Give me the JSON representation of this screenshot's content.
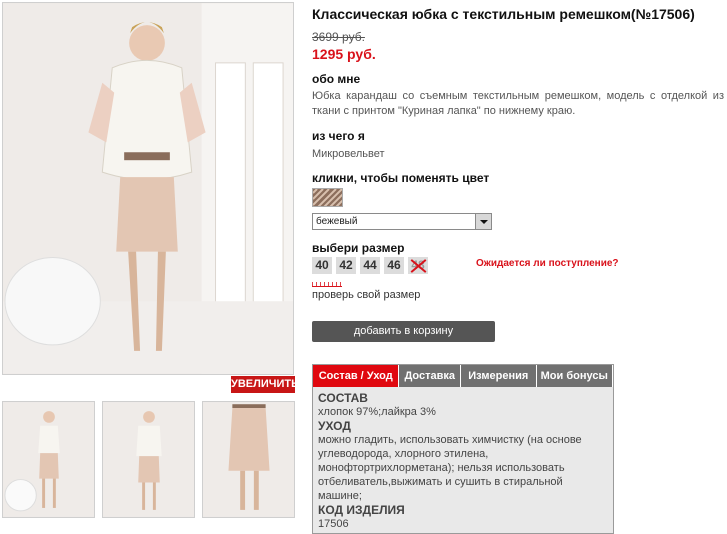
{
  "product": {
    "title": "Классическая юбка с текстильным ремешком(№17506)",
    "old_price": "3699 руб.",
    "new_price": "1295 руб."
  },
  "gallery": {
    "zoom_label": "УВЕЛИЧИТЬ"
  },
  "about": {
    "heading": "обо мне",
    "text": "Юбка карандаш со съемным текстильным ремешком, модель с отделкой из ткани с принтом \"Куриная лапка\" по нижнему краю."
  },
  "material": {
    "heading": "из чего я",
    "value": "Микровельвет"
  },
  "color": {
    "heading": "кликни, чтобы поменять цвет",
    "selected": "бежевый"
  },
  "size": {
    "heading": "выбери размер",
    "options": [
      "40",
      "42",
      "44",
      "46",
      "48"
    ],
    "await_label": "Ожидается ли поступление?",
    "check_label": "проверь свой размер"
  },
  "cart": {
    "button_label": "добавить в корзину"
  },
  "tabs": {
    "items": [
      "Состав / Уход",
      "Доставка",
      "Измерения",
      "Мои бонусы"
    ],
    "composition_heading": "СОСТАВ",
    "composition_value": "хлопок 97%;лайкра 3%",
    "care_heading": "УХОД",
    "care_value": "можно гладить, использовать химчистку (на основе углеводорода, хлорного этилена, монофтортрихлорметана); нельзя использовать отбеливатель,выжимать и сушить в стиральной машине;",
    "code_heading": "КОД ИЗДЕЛИЯ",
    "code_value": "17506"
  },
  "colors": {
    "accent": "#d9121b",
    "tab_active": "#e0080f",
    "tab_inactive": "#707070",
    "button": "#555555"
  }
}
